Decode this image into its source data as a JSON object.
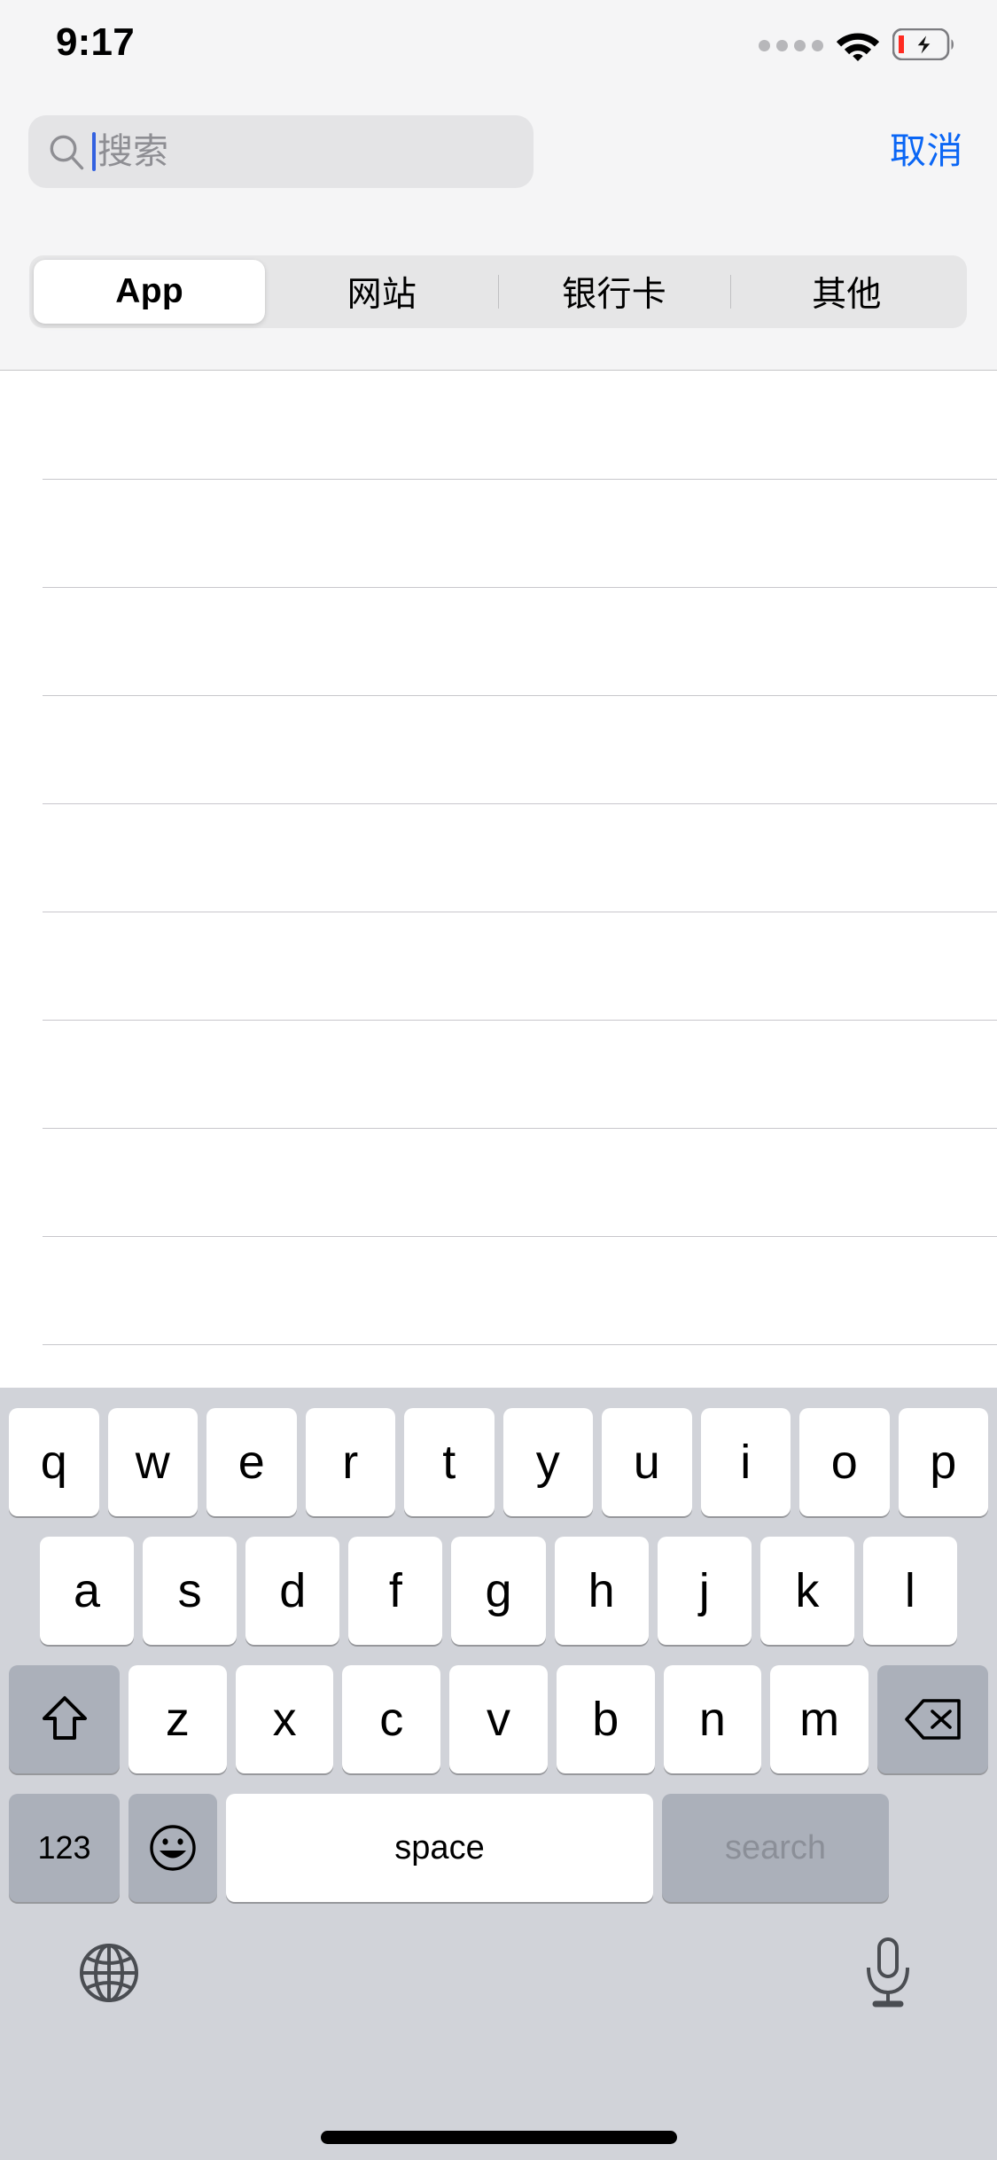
{
  "status_bar": {
    "time": "9:17",
    "signal_icon": "signal-dots-icon",
    "wifi_icon": "wifi-icon",
    "battery_icon": "battery-charging-icon",
    "battery_level_low": true
  },
  "search": {
    "placeholder": "搜索",
    "value": "",
    "icon": "search-magnifier-icon",
    "cancel_label": "取消",
    "cancel_color": "#0a66f5",
    "caret_color": "#3361e0",
    "field_bg": "#e4e4e6"
  },
  "segmented_control": {
    "selected_index": 0,
    "items": [
      {
        "label": "App"
      },
      {
        "label": "网站"
      },
      {
        "label": "银行卡"
      },
      {
        "label": "其他"
      }
    ],
    "track_bg": "#e6e6e7",
    "selected_bg": "#ffffff"
  },
  "results": {
    "rows": [
      {
        "label": ""
      },
      {
        "label": ""
      },
      {
        "label": ""
      },
      {
        "label": ""
      },
      {
        "label": ""
      },
      {
        "label": ""
      },
      {
        "label": ""
      },
      {
        "label": ""
      },
      {
        "label": ""
      }
    ],
    "separator_color": "#c8c7cc"
  },
  "keyboard": {
    "background": "#d1d3d9",
    "key_bg": "#ffffff",
    "modifier_key_bg": "#abb0ba",
    "row1": [
      "q",
      "w",
      "e",
      "r",
      "t",
      "y",
      "u",
      "i",
      "o",
      "p"
    ],
    "row2": [
      "a",
      "s",
      "d",
      "f",
      "g",
      "h",
      "j",
      "k",
      "l"
    ],
    "row3": [
      "z",
      "x",
      "c",
      "v",
      "b",
      "n",
      "m"
    ],
    "shift_icon": "shift-arrow-icon",
    "backspace_icon": "backspace-delete-icon",
    "numbers_label": "123",
    "emoji_icon": "emoji-smiley-icon",
    "space_label": "space",
    "return_label": "search",
    "return_disabled": true,
    "globe_icon": "globe-language-icon",
    "mic_icon": "microphone-dictation-icon"
  },
  "home_indicator": {
    "color": "#000000"
  }
}
